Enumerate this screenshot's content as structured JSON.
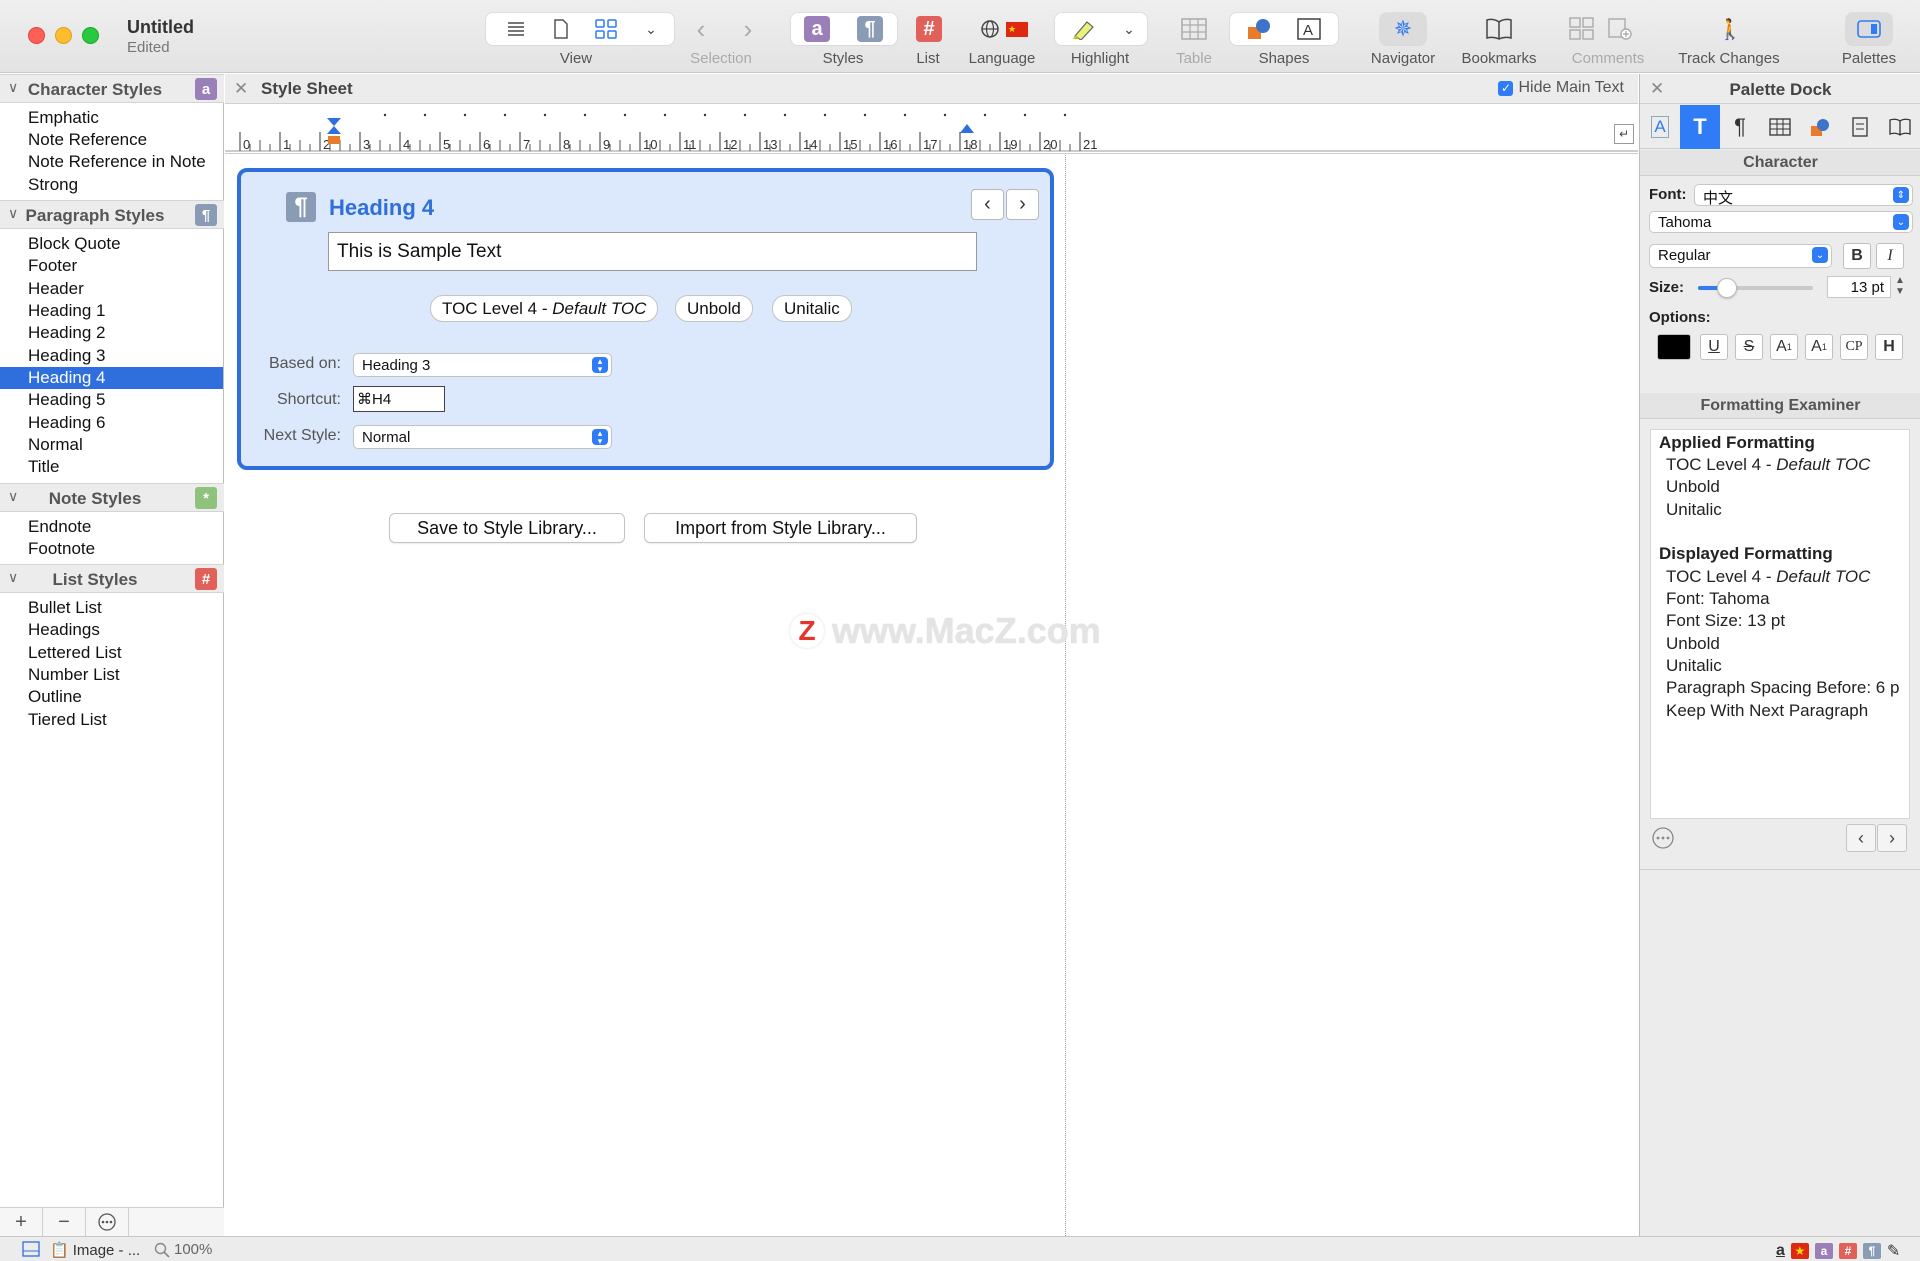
{
  "window": {
    "title": "Untitled",
    "subtitle": "Edited"
  },
  "toolbar": {
    "view_label": "View",
    "selection_label": "Selection",
    "styles_label": "Styles",
    "list_label": "List",
    "language_label": "Language",
    "highlight_label": "Highlight",
    "table_label": "Table",
    "shapes_label": "Shapes",
    "navigator_label": "Navigator",
    "bookmarks_label": "Bookmarks",
    "comments_label": "Comments",
    "track_changes_label": "Track Changes",
    "palettes_label": "Palettes"
  },
  "sidebar": {
    "character_styles": {
      "title": "Character Styles",
      "badge": "a",
      "items": [
        "Emphatic",
        "Note Reference",
        "Note Reference in Note",
        "Strong"
      ]
    },
    "paragraph_styles": {
      "title": "Paragraph Styles",
      "badge": "¶",
      "items": [
        "Block Quote",
        "Footer",
        "Header",
        "Heading 1",
        "Heading 2",
        "Heading 3",
        "Heading 4",
        "Heading 5",
        "Heading 6",
        "Normal",
        "Title"
      ],
      "selected": "Heading 4"
    },
    "note_styles": {
      "title": "Note Styles",
      "badge": "*",
      "items": [
        "Endnote",
        "Footnote"
      ]
    },
    "list_styles": {
      "title": "List Styles",
      "badge": "#",
      "items": [
        "Bullet List",
        "Headings",
        "Lettered List",
        "Number List",
        "Outline",
        "Tiered List"
      ]
    }
  },
  "center": {
    "title": "Style Sheet",
    "hide_main_text": "Hide Main Text",
    "ruler_numbers": [
      "0",
      "1",
      "2",
      "3",
      "4",
      "5",
      "6",
      "7",
      "8",
      "9",
      "10",
      "11",
      "12",
      "13",
      "14",
      "15",
      "16",
      "17",
      "18",
      "19",
      "20",
      "21"
    ],
    "card": {
      "title": "Heading 4",
      "sample_text": "This is Sample Text",
      "pill_toc_prefix": "TOC Level 4 - ",
      "pill_toc_italic": "Default TOC",
      "pill_unbold": "Unbold",
      "pill_unitalic": "Unitalic",
      "based_on_label": "Based on:",
      "based_on_value": "Heading 3",
      "shortcut_label": "Shortcut:",
      "shortcut_value": "⌘H4",
      "next_style_label": "Next Style:",
      "next_style_value": "Normal"
    },
    "save_button": "Save to Style Library...",
    "import_button": "Import from Style Library...",
    "watermark": "www.MacZ.com"
  },
  "palette": {
    "title": "Palette Dock",
    "character_header": "Character",
    "font_label": "Font:",
    "font_script": "中文",
    "font_family": "Tahoma",
    "font_style": "Regular",
    "size_label": "Size:",
    "size_value": "13 pt",
    "size_slider_fraction": 0.25,
    "options_label": "Options:",
    "examiner_header": "Formatting Examiner",
    "applied_heading": "Applied Formatting",
    "applied_toc_prefix": "TOC Level 4 - ",
    "applied_toc_italic": "Default TOC",
    "applied_unbold": "Unbold",
    "applied_unitalic": "Unitalic",
    "displayed_heading": "Displayed Formatting",
    "displayed_toc_prefix": "TOC Level 4 - ",
    "displayed_toc_italic": "Default TOC",
    "displayed_font": "Font: Tahoma",
    "displayed_size": "Font Size: 13 pt",
    "displayed_unbold": "Unbold",
    "displayed_unitalic": "Unitalic",
    "displayed_spacing": "Paragraph Spacing Before: 6 p",
    "displayed_keep": "Keep With Next Paragraph"
  },
  "status": {
    "image_label": "Image - ...",
    "zoom": "100%"
  },
  "colors": {
    "accent": "#2f6fdd",
    "character_badge": "#9a7fb8",
    "paragraph_badge": "#8a9bb5",
    "note_badge": "#8fc27d",
    "list_badge": "#e0605a"
  }
}
